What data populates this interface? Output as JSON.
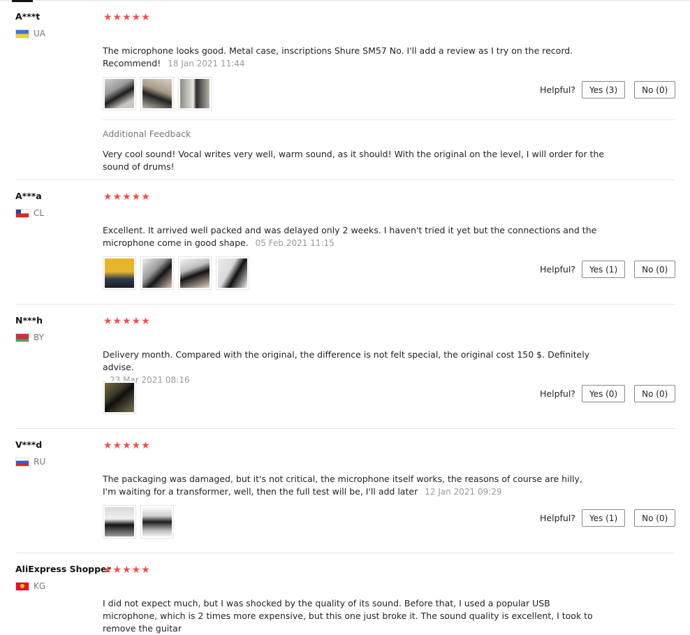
{
  "helpful_label": "Helpful?",
  "reviews": [
    {
      "user": "A***t",
      "country": "UA",
      "text": "The microphone looks good. Metal case, inscriptions Shure SM57 No. I'll add a review as I try on the record. Recommend!",
      "date": "18 Jan 2021 11:44",
      "yes": "Yes (3)",
      "no": "No (0)",
      "additional_feedback_title": "Additional Feedback",
      "additional_feedback": "Very cool sound! Vocal writes very well, warm sound, as it should! With the original on the level, I will order for the sound of drums!"
    },
    {
      "user": "A***a",
      "country": "CL",
      "text": "Excellent. It arrived well packed and was delayed only 2 weeks. I haven't tried it yet but the connections and the microphone come in good shape.",
      "date": "05 Feb 2021 11:15",
      "yes": "Yes (1)",
      "no": "No (0)"
    },
    {
      "user": "N***h",
      "country": "BY",
      "text": "Delivery month. Compared with the original, the difference is not felt special, the original cost 150 $. Definitely advise.",
      "date": "23 Mar 2021 08:16",
      "yes": "Yes (0)",
      "no": "No (0)"
    },
    {
      "user": "V***d",
      "country": "RU",
      "text": "The packaging was damaged, but it's not critical, the microphone itself works, the reasons of course are hilly, I'm waiting for a transformer, well, then the full test will be, I'll add later",
      "date": "12 Jan 2021 09:29",
      "yes": "Yes (1)",
      "no": "No (0)"
    },
    {
      "user": "AliExpress Shopper",
      "country": "KG",
      "text": "I did not expect much, but I was shocked by the quality of its sound. Before that, I used a popular USB microphone, which is 2 times more expensive, but this one just broke it. The sound quality is excellent, I took to remove the guitar"
    }
  ],
  "stars": "★★★★★",
  "rating_each": 5
}
